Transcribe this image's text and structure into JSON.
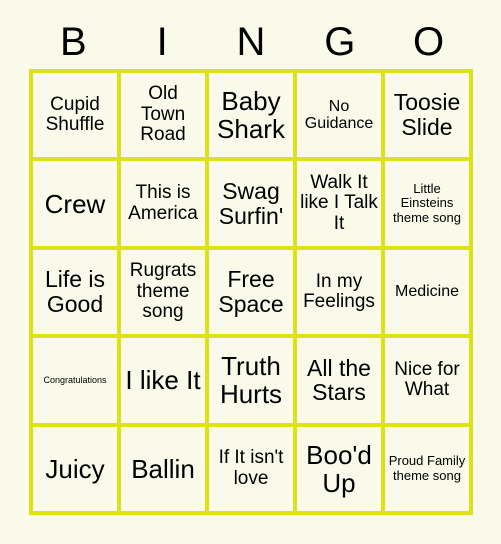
{
  "card": {
    "title": "BINGO",
    "background_color": "#f9faea",
    "border_color": "#dde118",
    "text_color": "#000000"
  },
  "header": {
    "letters": [
      "B",
      "I",
      "N",
      "G",
      "O"
    ]
  },
  "grid": {
    "columns": 5,
    "rows": 5,
    "cells": [
      [
        {
          "text": "Cupid Shuffle",
          "size": "md"
        },
        {
          "text": "Old Town Road",
          "size": "md"
        },
        {
          "text": "Baby Shark",
          "size": "xl"
        },
        {
          "text": "No Guidance",
          "size": "sm"
        },
        {
          "text": "Toosie Slide",
          "size": "lg"
        }
      ],
      [
        {
          "text": "Crew",
          "size": "xl"
        },
        {
          "text": "This is America",
          "size": "md"
        },
        {
          "text": "Swag Surfin'",
          "size": "lg"
        },
        {
          "text": "Walk It like I Talk It",
          "size": "md"
        },
        {
          "text": "Little Einsteins theme song",
          "size": "xs"
        }
      ],
      [
        {
          "text": "Life is Good",
          "size": "lg"
        },
        {
          "text": "Rugrats theme song",
          "size": "md"
        },
        {
          "text": "Free Space",
          "size": "lg"
        },
        {
          "text": "In my Feelings",
          "size": "md"
        },
        {
          "text": "Medicine",
          "size": "sm"
        }
      ],
      [
        {
          "text": "Congratulations",
          "size": "xxs"
        },
        {
          "text": "I like It",
          "size": "xl"
        },
        {
          "text": "Truth Hurts",
          "size": "xl"
        },
        {
          "text": "All the Stars",
          "size": "lg"
        },
        {
          "text": "Nice for What",
          "size": "md"
        }
      ],
      [
        {
          "text": "Juicy",
          "size": "xl"
        },
        {
          "text": "Ballin",
          "size": "xl"
        },
        {
          "text": "If It isn't love",
          "size": "md"
        },
        {
          "text": "Boo'd Up",
          "size": "xl"
        },
        {
          "text": "Proud Family theme song",
          "size": "xs"
        }
      ]
    ]
  }
}
